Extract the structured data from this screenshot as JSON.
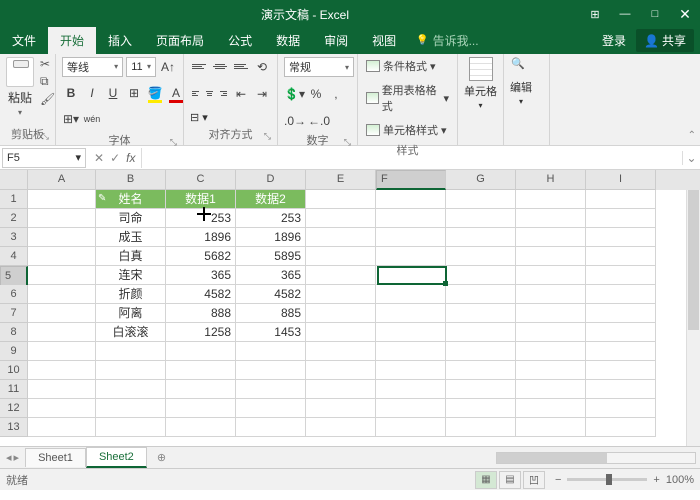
{
  "app": {
    "title": "演示文稿 - Excel"
  },
  "tabs": {
    "file": "文件",
    "home": "开始",
    "insert": "插入",
    "layout": "页面布局",
    "formula": "公式",
    "data": "数据",
    "review": "审阅",
    "view": "视图",
    "tellme": "告诉我...",
    "login": "登录",
    "share": "共享"
  },
  "ribbon": {
    "clipboard": {
      "paste": "粘贴",
      "label": "剪贴板"
    },
    "font": {
      "name": "等线",
      "size": "11",
      "label": "字体"
    },
    "align": {
      "label": "对齐方式"
    },
    "number": {
      "format": "常规",
      "label": "数字"
    },
    "styles": {
      "cond": "条件格式",
      "table": "套用表格格式",
      "cell": "单元格样式",
      "label": "样式"
    },
    "cells": {
      "label": "单元格"
    },
    "editing": {
      "label": "编辑"
    }
  },
  "namebox": "F5",
  "columns": [
    "A",
    "B",
    "C",
    "D",
    "E",
    "F",
    "G",
    "H",
    "I"
  ],
  "rownums": [
    1,
    2,
    3,
    4,
    5,
    6,
    7,
    8,
    9,
    10,
    11,
    12,
    13
  ],
  "headers": {
    "b": "姓名",
    "c": "数据1",
    "d": "数据2"
  },
  "data": [
    {
      "b": "司命",
      "c": "253",
      "d": "253"
    },
    {
      "b": "成玉",
      "c": "1896",
      "d": "1896"
    },
    {
      "b": "白真",
      "c": "5682",
      "d": "5895"
    },
    {
      "b": "连宋",
      "c": "365",
      "d": "365"
    },
    {
      "b": "折颜",
      "c": "4582",
      "d": "4582"
    },
    {
      "b": "阿离",
      "c": "888",
      "d": "885"
    },
    {
      "b": "白滚滚",
      "c": "1258",
      "d": "1453"
    }
  ],
  "sheets": {
    "s1": "Sheet1",
    "s2": "Sheet2"
  },
  "status": {
    "ready": "就绪",
    "zoom": "100%"
  },
  "chart_data": {
    "type": "table",
    "columns": [
      "姓名",
      "数据1",
      "数据2"
    ],
    "rows": [
      [
        "司命",
        253,
        253
      ],
      [
        "成玉",
        1896,
        1896
      ],
      [
        "白真",
        5682,
        5895
      ],
      [
        "连宋",
        365,
        365
      ],
      [
        "折颜",
        4582,
        4582
      ],
      [
        "阿离",
        888,
        885
      ],
      [
        "白滚滚",
        1258,
        1453
      ]
    ]
  }
}
